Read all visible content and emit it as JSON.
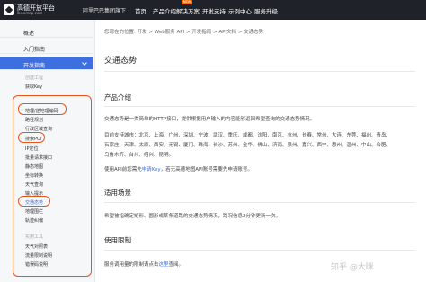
{
  "header": {
    "logo_title": "高德开放平台",
    "logo_subtitle": "lbs.amap.com",
    "group": "阿里巴巴集团旗下",
    "nav": [
      "首页",
      "产品介绍",
      "解决方案",
      "开发支持",
      "示例中心",
      "服务升级"
    ],
    "new_badge": "NEW"
  },
  "sidebar": {
    "top": [
      "概述",
      "入门指南",
      "开发指南"
    ],
    "section_label": "创建工程",
    "get_key": "获取Key",
    "items": [
      "地理/逆地理编码",
      "路径规划",
      "行政区域查询",
      "搜索POI",
      "IP定位",
      "批量请求接口",
      "静态地图",
      "坐标转换",
      "天气查询",
      "输入提示",
      "交通态势",
      "地理围栏",
      "轨迹纠偏"
    ],
    "practical_label": "实用工具",
    "tools": [
      "天气对照表",
      "流量限制说明",
      "错误码说明"
    ]
  },
  "content": {
    "breadcrumb": "您现在的位置:  开发 > Web服务 API > 开发指南 > API文档 > 交通态势",
    "title": "交通态势",
    "section1": "产品介绍",
    "intro_line1": "交通态势是一类简单的HTTP接口，提供根据用户输入的内容能够返回希望查询的交通态势情况。",
    "intro_line2": "目前支持城市：北京、上海、广州、深圳、宁波、武汉、重庆、成都、沈阳、南京、杭州、长春、常州、大连、东莞、福州、青岛、",
    "intro_line3": "石家庄、天津、太原、西安、无锡、厦门、珠海、长沙、苏州、金华、佛山、济南、泉州、嘉兴、西宁、惠州、温州、中山、合肥、",
    "intro_line4": "乌鲁木齐、台州、绍兴、昆明。",
    "intro_line5_pre": "使用API前您需先",
    "intro_line5_link": "申请Key",
    "intro_line5_post": "，若无高德地图API账号需要先申请账号。",
    "section2": "适用场景",
    "scene_line": "希望被指确定矩形、圆形或某条道路的交通态势情况，路况信息2分钟更新一次。",
    "section3": "使用限制",
    "limit_pre": "服务调用量的限制请点击",
    "limit_link": "这里",
    "limit_post": "查阅。"
  },
  "watermark": "知乎 @大眯"
}
